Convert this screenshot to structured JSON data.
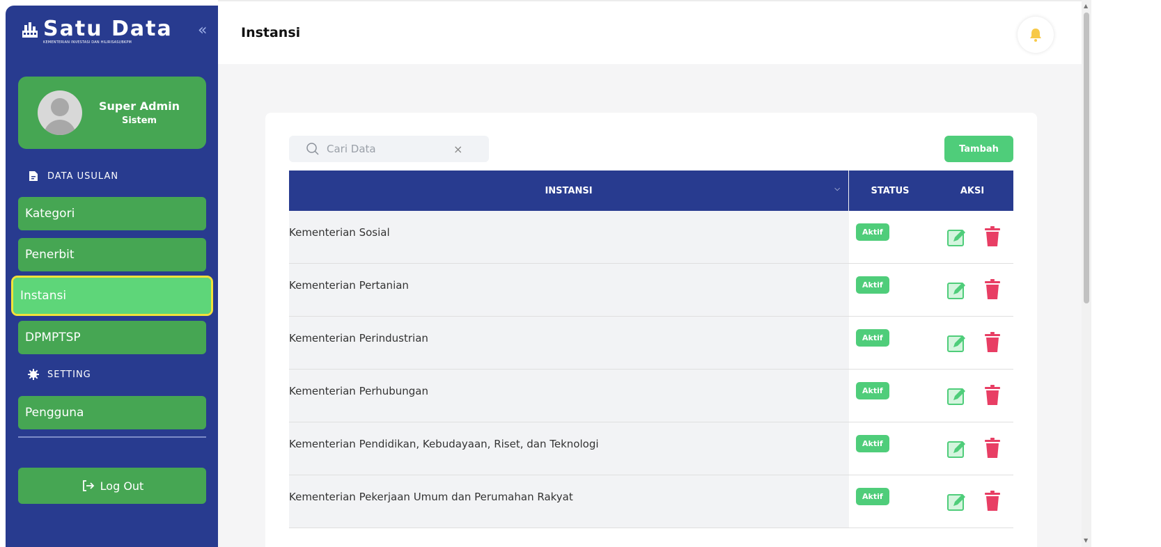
{
  "brand": {
    "title": "Satu Data",
    "subtitle": "KEMENTERIAN INVESTASI DAN HILIRISASI/BKPM",
    "collapse_icon": "double-chevron-left-icon"
  },
  "profile": {
    "name": "Super Admin",
    "role": "Sistem"
  },
  "sidebar": {
    "section_data": "DATA USULAN",
    "section_setting": "SETTING",
    "items": [
      {
        "label": "Kategori"
      },
      {
        "label": "Penerbit"
      },
      {
        "label": "Instansi",
        "active": true
      },
      {
        "label": "DPMPTSP"
      }
    ],
    "setting_items": [
      {
        "label": "Pengguna"
      }
    ],
    "logout_label": "Log Out"
  },
  "header": {
    "title": "Instansi",
    "bell_icon": "bell-icon"
  },
  "search": {
    "placeholder": "Cari Data",
    "value": ""
  },
  "toolbar": {
    "add_label": "Tambah"
  },
  "table": {
    "columns": [
      "INSTANSI",
      "STATUS",
      "AKSI"
    ],
    "rows": [
      {
        "instansi": "Kementerian Sosial",
        "status": "Aktif"
      },
      {
        "instansi": "Kementerian Pertanian",
        "status": "Aktif"
      },
      {
        "instansi": "Kementerian Perindustrian",
        "status": "Aktif"
      },
      {
        "instansi": "Kementerian Perhubungan",
        "status": "Aktif"
      },
      {
        "instansi": "Kementerian Pendidikan, Kebudayaan, Riset, dan Teknologi",
        "status": "Aktif"
      },
      {
        "instansi": "Kementerian Pekerjaan Umum dan Perumahan Rakyat",
        "status": "Aktif"
      }
    ]
  },
  "colors": {
    "sidebar_bg": "#283b8f",
    "nav_green": "#46a653",
    "active_green": "#5ed679",
    "accent_green": "#4fcd7a",
    "delete_red": "#e83e64",
    "active_outline": "#f2e23a"
  }
}
